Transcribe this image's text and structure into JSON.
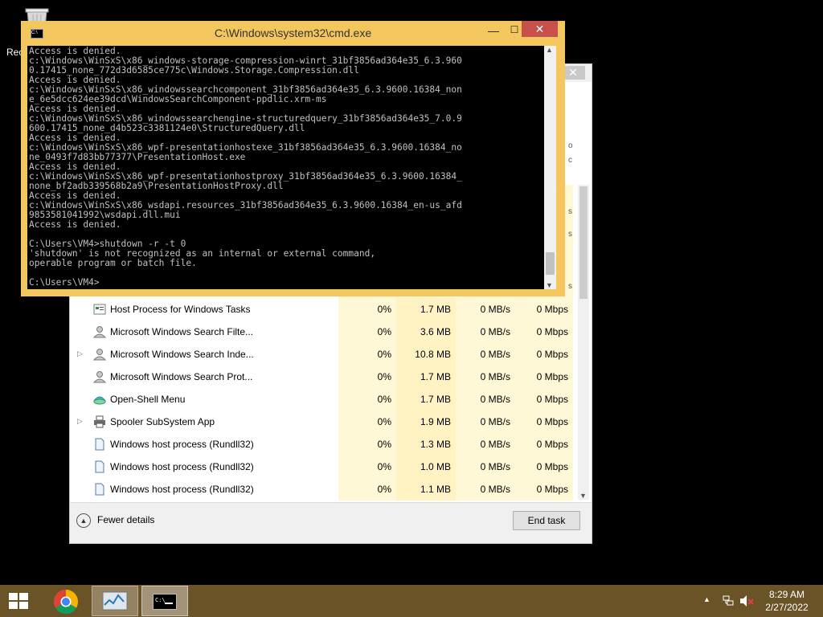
{
  "desktop": {
    "recycle_bin_label": "Rec"
  },
  "task_manager": {
    "close_glyph": "✕",
    "side_fragments": [
      "o",
      "c",
      "s",
      "s",
      "s"
    ],
    "processes": [
      {
        "name": "Host Process for Windows Tasks",
        "expandable": false,
        "icon": "task-host-icon",
        "cpu": "0%",
        "memory": "1.7 MB",
        "disk": "0 MB/s",
        "network": "0 Mbps"
      },
      {
        "name": "Microsoft Windows Search Filte...",
        "expandable": false,
        "icon": "search-filter-user-icon",
        "cpu": "0%",
        "memory": "3.6 MB",
        "disk": "0 MB/s",
        "network": "0 Mbps"
      },
      {
        "name": "Microsoft Windows Search Inde...",
        "expandable": true,
        "icon": "search-indexer-user-icon",
        "cpu": "0%",
        "memory": "10.8 MB",
        "disk": "0 MB/s",
        "network": "0 Mbps"
      },
      {
        "name": "Microsoft Windows Search Prot...",
        "expandable": false,
        "icon": "search-protocol-user-icon",
        "cpu": "0%",
        "memory": "1.7 MB",
        "disk": "0 MB/s",
        "network": "0 Mbps"
      },
      {
        "name": "Open-Shell Menu",
        "expandable": false,
        "icon": "open-shell-icon",
        "cpu": "0%",
        "memory": "1.7 MB",
        "disk": "0 MB/s",
        "network": "0 Mbps"
      },
      {
        "name": "Spooler SubSystem App",
        "expandable": true,
        "icon": "printer-icon",
        "cpu": "0%",
        "memory": "1.9 MB",
        "disk": "0 MB/s",
        "network": "0 Mbps"
      },
      {
        "name": "Windows host process (Rundll32)",
        "expandable": false,
        "icon": "document-icon",
        "cpu": "0%",
        "memory": "1.3 MB",
        "disk": "0 MB/s",
        "network": "0 Mbps"
      },
      {
        "name": "Windows host process (Rundll32)",
        "expandable": false,
        "icon": "document-icon",
        "cpu": "0%",
        "memory": "1.0 MB",
        "disk": "0 MB/s",
        "network": "0 Mbps"
      },
      {
        "name": "Windows host process (Rundll32)",
        "expandable": false,
        "icon": "document-icon",
        "cpu": "0%",
        "memory": "1.1 MB",
        "disk": "0 MB/s",
        "network": "0 Mbps"
      }
    ],
    "fewer_details_label": "Fewer details",
    "end_task_label": "End task"
  },
  "cmd": {
    "title": "C:\\Windows\\system32\\cmd.exe",
    "min_glyph": "—",
    "max_glyph": "☐",
    "close_glyph": "✕",
    "lines": [
      "Access is denied.",
      "c:\\Windows\\WinSxS\\x86_windows-storage-compression-winrt_31bf3856ad364e35_6.3.960",
      "0.17415_none_772d3d6585ce775c\\Windows.Storage.Compression.dll",
      "Access is denied.",
      "c:\\Windows\\WinSxS\\x86_windowssearchcomponent_31bf3856ad364e35_6.3.9600.16384_non",
      "e_6e5dcc624ee39dcd\\WindowsSearchComponent-ppdlic.xrm-ms",
      "Access is denied.",
      "c:\\Windows\\WinSxS\\x86_windowssearchengine-structuredquery_31bf3856ad364e35_7.0.9",
      "600.17415_none_d4b523c3381124e0\\StructuredQuery.dll",
      "Access is denied.",
      "c:\\Windows\\WinSxS\\x86_wpf-presentationhostexe_31bf3856ad364e35_6.3.9600.16384_no",
      "ne_0493f7d83bb77377\\PresentationHost.exe",
      "Access is denied.",
      "c:\\Windows\\WinSxS\\x86_wpf-presentationhostproxy_31bf3856ad364e35_6.3.9600.16384_",
      "none_bf2adb339568b2a9\\PresentationHostProxy.dll",
      "Access is denied.",
      "c:\\Windows\\WinSxS\\x86_wsdapi.resources_31bf3856ad364e35_6.3.9600.16384_en-us_afd",
      "9853581041992\\wsdapi.dll.mui",
      "Access is denied.",
      "",
      "C:\\Users\\VM4>shutdown -r -t 0",
      "'shutdown' is not recognized as an internal or external command,",
      "operable program or batch file.",
      "",
      "C:\\Users\\VM4>"
    ]
  },
  "taskbar": {
    "tray_arrow": "▲",
    "time": "8:29 AM",
    "date": "2/27/2022",
    "colors": {
      "background": "#6b5328",
      "cmd_frame": "#f4c75e",
      "cmd_close": "#c7504b"
    }
  }
}
